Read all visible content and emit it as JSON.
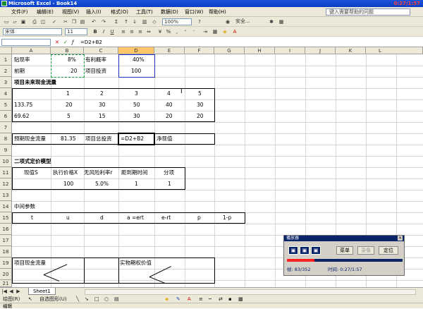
{
  "window": {
    "title": "Microsoft Excel - Book14",
    "clock": "0:27/1:57"
  },
  "menu": [
    "文件(F)",
    "编辑(E)",
    "视图(V)",
    "插入(I)",
    "格式(O)",
    "工具(T)",
    "数据(D)",
    "窗口(W)",
    "帮助(H)"
  ],
  "help_placeholder": "键入需要帮助的问题",
  "toolbar": {
    "font": "宋体",
    "size": "11",
    "zoom": "100%",
    "security": "安全..."
  },
  "formula": {
    "name_box": "",
    "content": "=D2+B2"
  },
  "columns": [
    "A",
    "B",
    "C",
    "D",
    "E",
    "F",
    "G",
    "H",
    "I",
    "J",
    "K",
    "L"
  ],
  "rows": [
    "1",
    "2",
    "3",
    "4",
    "5",
    "6",
    "7",
    "8",
    "9",
    "10",
    "11",
    "12",
    "13",
    "14",
    "15",
    "16",
    "17",
    "18",
    "19",
    "20",
    "21"
  ],
  "cells": {
    "a1": "贴现率",
    "b1": "8%",
    "c1": "有利概率",
    "d1": "40%",
    "a2": "前期",
    "b2": "20",
    "c2": "项目投资",
    "d2": "100",
    "a3": "项目未来现金流量",
    "b4": "1",
    "c4": "2",
    "d4": "3",
    "e4": "4",
    "f4": "5",
    "a5": "133.75",
    "b5": "20",
    "c5": "30",
    "d5": "50",
    "e5": "40",
    "f5": "30",
    "a6": "69.62",
    "b6": "5",
    "c6": "15",
    "d6": "30",
    "e6": "20",
    "f6": "20",
    "a8": "预期现金流量",
    "b8": "81.35",
    "c8": "项目总投资",
    "d8": "=D2+B2",
    "e8": "净现值",
    "a10": "二项式定价模型",
    "a11": "现值S",
    "b11": "执行价格X",
    "c11": "无风险利率r",
    "d11": "距到期时间",
    "e11": "分项",
    "b12": "100",
    "c12": "5.0%",
    "d12": "1",
    "e12": "1",
    "a14": "中间参数",
    "a15": "t",
    "b15": "u",
    "c15": "d",
    "d15": "a =ert",
    "e15": "e-rt",
    "f15": "p",
    "g15": "1-p",
    "a18": "项目现金流量",
    "d18": "实物期权价值"
  },
  "sheet_tab": "Sheet1",
  "drawbar": {
    "draw": "绘图(R)",
    "autoshapes": "自选图形(U)"
  },
  "status": "编辑",
  "player": {
    "title": "播放器",
    "menu": "菜单",
    "record": "录像",
    "locate": "定位",
    "frame": "帧: 83/352",
    "time": "时间: 0:27/1:57",
    "progress": 0.236
  }
}
